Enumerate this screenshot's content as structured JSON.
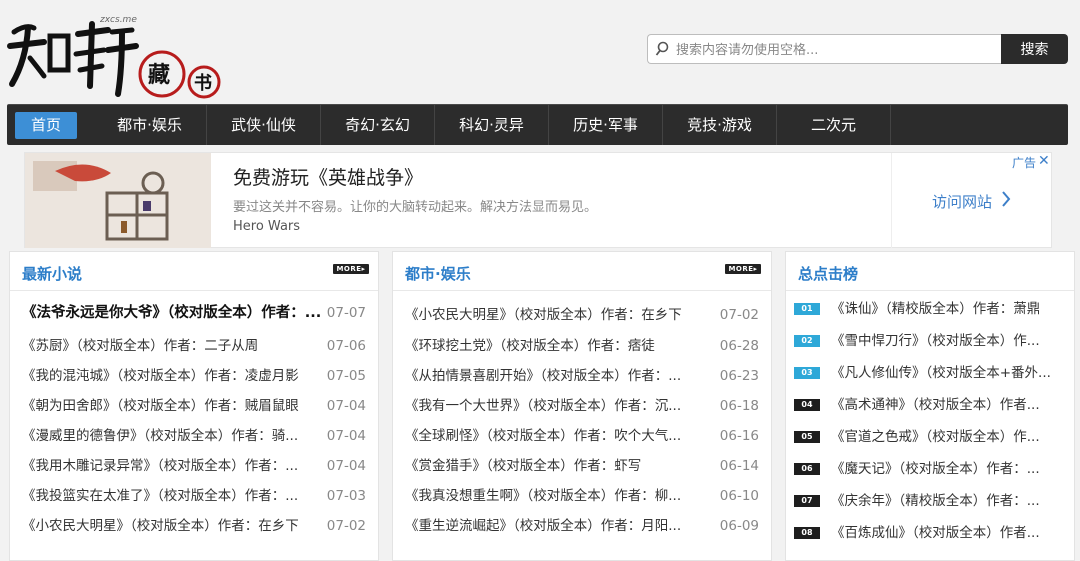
{
  "logo": {
    "main": "知轩",
    "sub": "藏书",
    "domain": "zxcs.me"
  },
  "search": {
    "placeholder": "搜索内容请勿使用空格...",
    "value": "",
    "button": "搜索"
  },
  "nav": [
    "首页",
    "都市·娱乐",
    "武侠·仙侠",
    "奇幻·玄幻",
    "科幻·灵异",
    "历史·军事",
    "竞技·游戏",
    "二次元"
  ],
  "ad": {
    "title": "免费游玩《英雄战争》",
    "desc": "要过这关并不容易。让你的大脑转动起来。解决方法显而易见。",
    "brand": "Hero Wars",
    "visit": "访问网站",
    "tag": "广告",
    "close": "✕"
  },
  "more_label": "MORE▸",
  "columns": {
    "latest": {
      "title": "最新小说",
      "items": [
        {
          "t": "《法爷永远是你大爷》（校对版全本）作者：...",
          "d": "07-07"
        },
        {
          "t": "《苏厨》（校对版全本）作者：二子从周",
          "d": "07-06"
        },
        {
          "t": "《我的混沌城》（校对版全本）作者：凌虚月影",
          "d": "07-05"
        },
        {
          "t": "《朝为田舍郎》（校对版全本）作者：贼眉鼠眼",
          "d": "07-04"
        },
        {
          "t": "《漫威里的德鲁伊》（校对版全本）作者：骑...",
          "d": "07-04"
        },
        {
          "t": "《我用木雕记录异常》（校对版全本）作者：...",
          "d": "07-04"
        },
        {
          "t": "《我投篮实在太准了》（校对版全本）作者：...",
          "d": "07-03"
        },
        {
          "t": "《小农民大明星》（校对版全本）作者：在乡下",
          "d": "07-02"
        }
      ]
    },
    "urban": {
      "title": "都市·娱乐",
      "items": [
        {
          "t": "《小农民大明星》（校对版全本）作者：在乡下",
          "d": "07-02"
        },
        {
          "t": "《环球挖土党》（校对版全本）作者：痞徒",
          "d": "06-28"
        },
        {
          "t": "《从拍情景喜剧开始》（校对版全本）作者：...",
          "d": "06-23"
        },
        {
          "t": "《我有一个大世界》（校对版全本）作者：沉...",
          "d": "06-18"
        },
        {
          "t": "《全球刷怪》（校对版全本）作者：吹个大气...",
          "d": "06-16"
        },
        {
          "t": "《赏金猎手》（校对版全本）作者：虾写",
          "d": "06-14"
        },
        {
          "t": "《我真没想重生啊》（校对版全本）作者：柳...",
          "d": "06-10"
        },
        {
          "t": "《重生逆流崛起》（校对版全本）作者：月阳...",
          "d": "06-09"
        }
      ]
    },
    "ranking": {
      "title": "总点击榜",
      "items": [
        {
          "r": "01",
          "t": "《诛仙》（精校版全本）作者：萧鼎"
        },
        {
          "r": "02",
          "t": "《雪中悍刀行》（校对版全本）作..."
        },
        {
          "r": "03",
          "t": "《凡人修仙传》（校对版全本+番外..."
        },
        {
          "r": "04",
          "t": "《高术通神》（校对版全本）作者..."
        },
        {
          "r": "05",
          "t": "《官道之色戒》（校对版全本）作..."
        },
        {
          "r": "06",
          "t": "《魔天记》（校对版全本）作者：..."
        },
        {
          "r": "07",
          "t": "《庆余年》（精校版全本）作者：..."
        },
        {
          "r": "08",
          "t": "《百炼成仙》（校对版全本）作者..."
        }
      ]
    }
  }
}
